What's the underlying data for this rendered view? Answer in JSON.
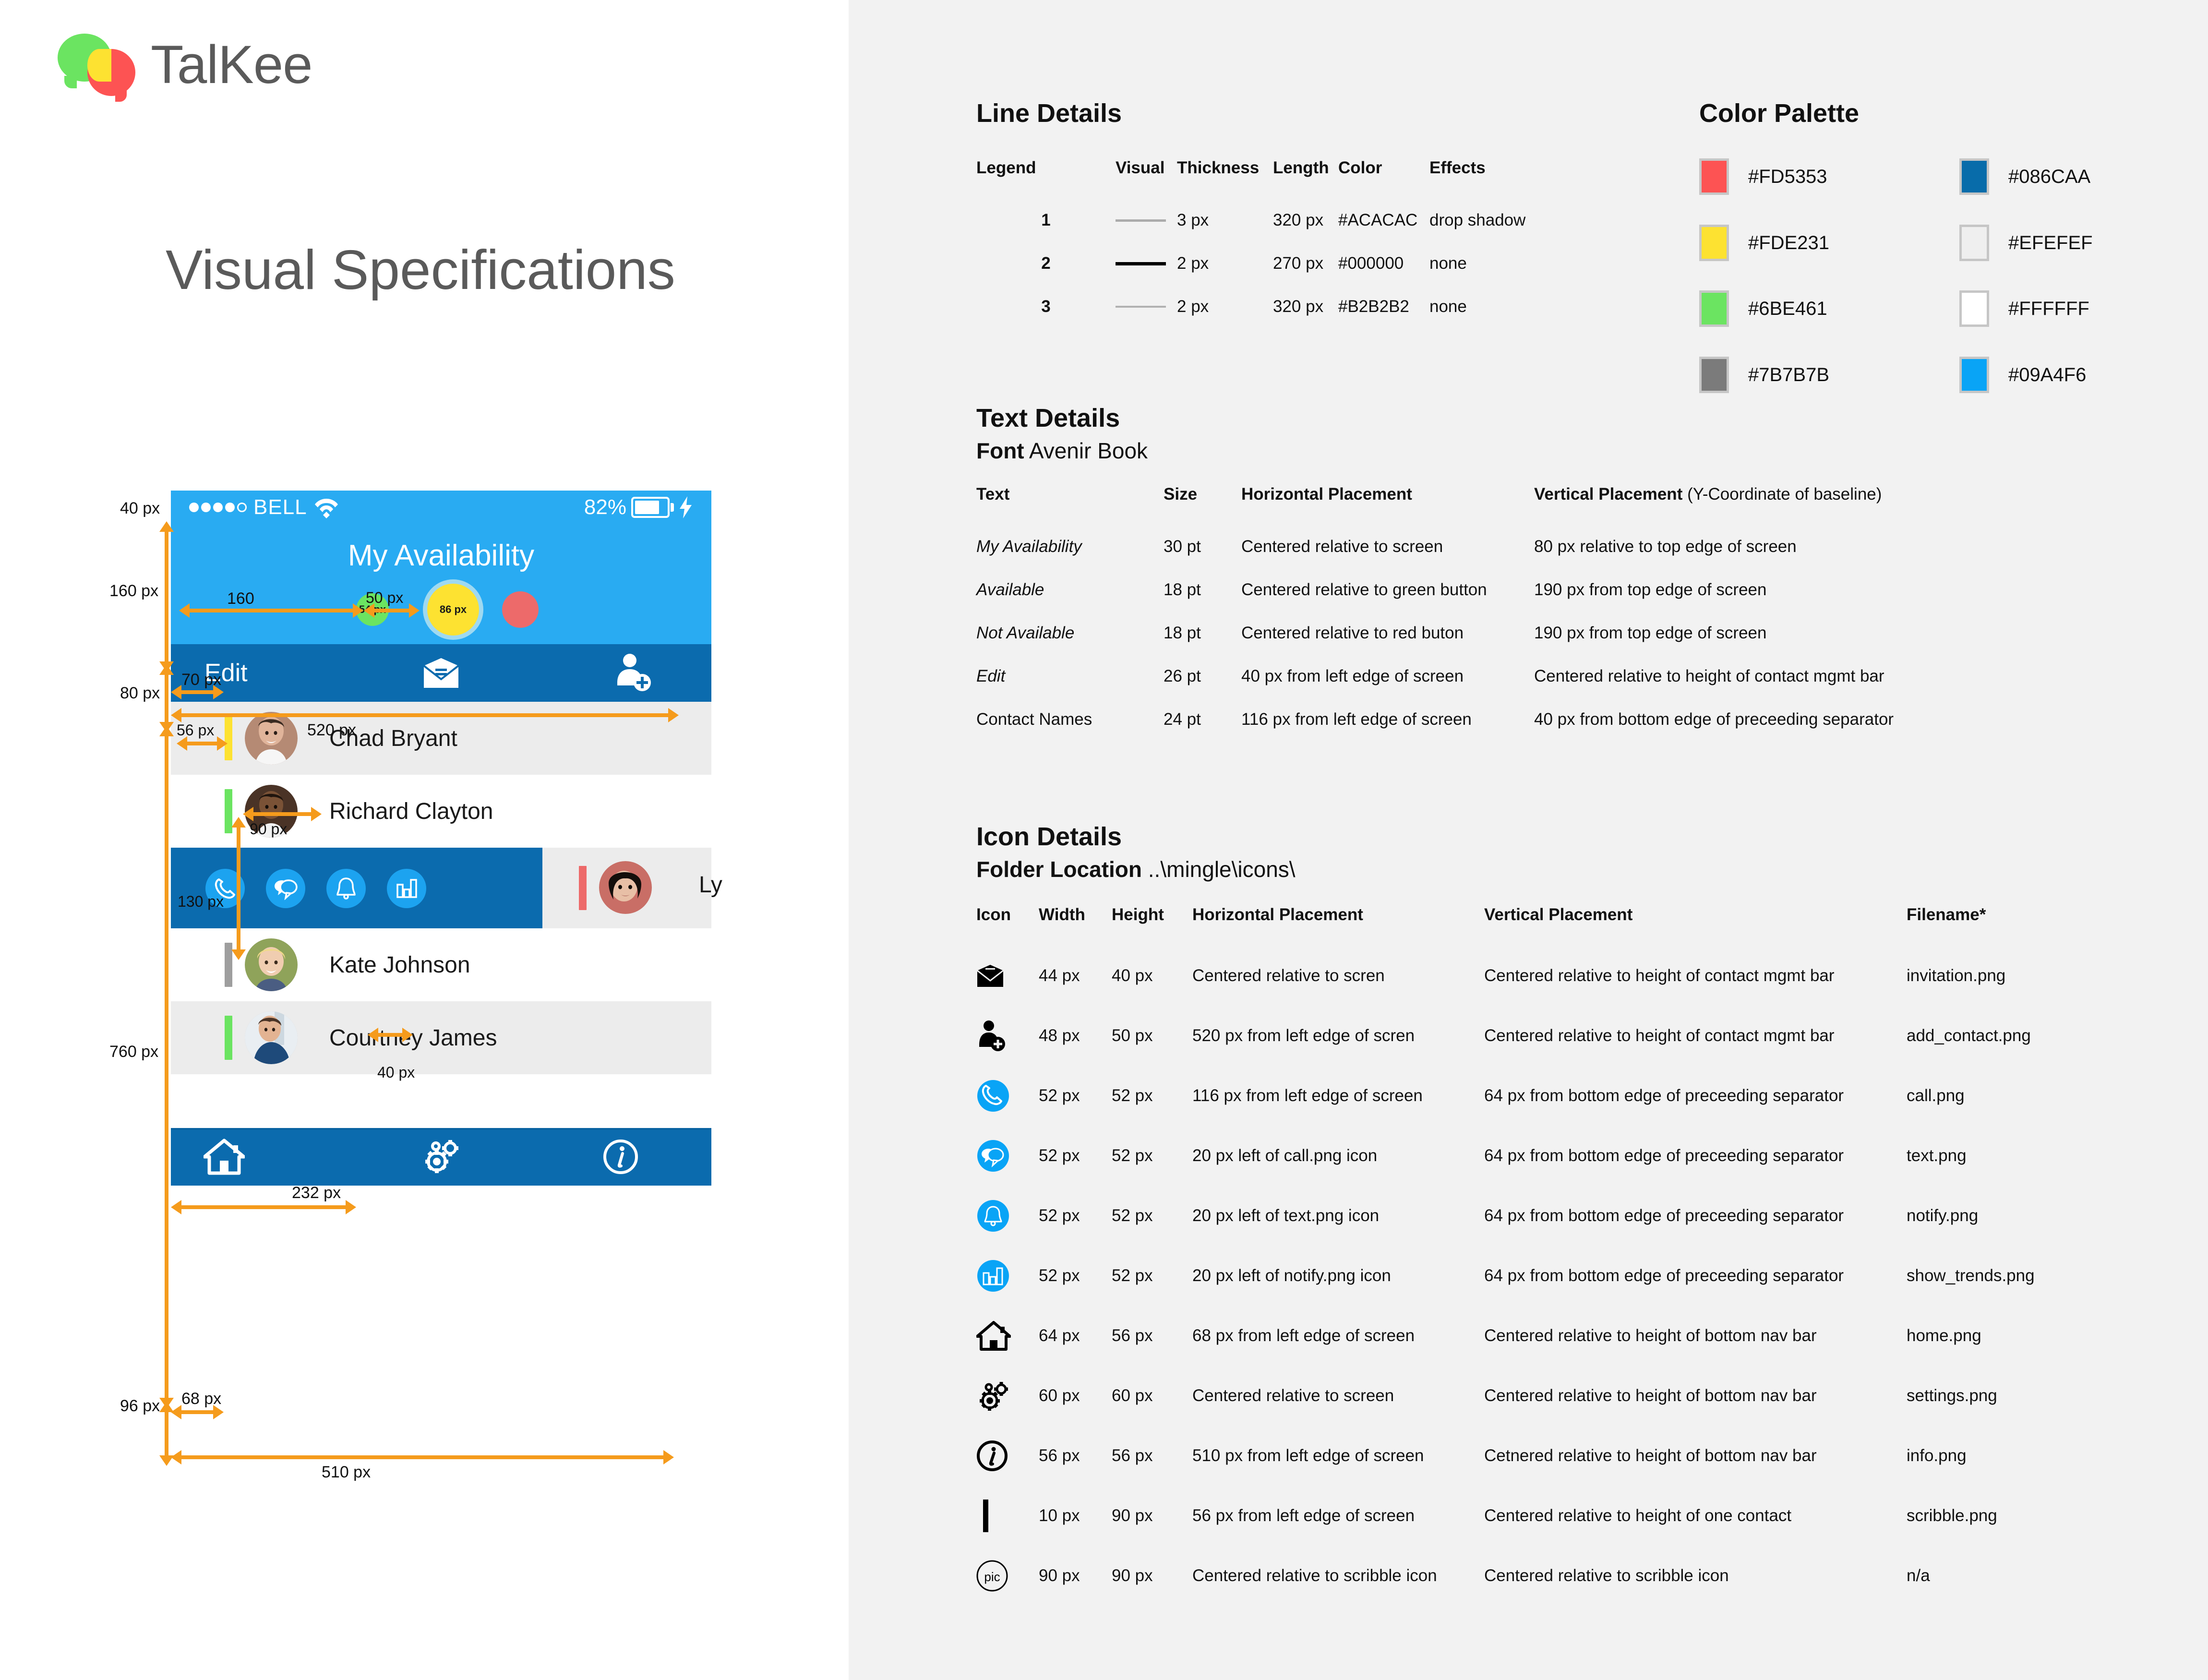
{
  "brand": {
    "name": "TalKee"
  },
  "page": {
    "title": "Visual Specifications"
  },
  "phone": {
    "status": {
      "carrier": "BELL",
      "battery_pct": "82%"
    },
    "hero_title": "My Availability",
    "buttons": {
      "green_label": "54 px",
      "yellow_label": "86 px"
    },
    "mgmt_bar": {
      "edit_label": "Edit"
    },
    "contacts": [
      {
        "name": "Chad Bryant",
        "scribble_color": "#FDE231"
      },
      {
        "name": "Richard Clayton",
        "scribble_color": "#6BE461"
      },
      {
        "name": "Ly",
        "scribble_color": "#ED6A6A"
      },
      {
        "name": "Kate Johnson",
        "scribble_color": "#9E9E9E"
      },
      {
        "name": "Courtney James",
        "scribble_color": "#6BE461"
      }
    ],
    "annotations": {
      "status_h": "40 px",
      "hero_h": "160 px",
      "mgmt_h": "80 px",
      "list_h": "760 px",
      "nav_h": "96 px",
      "green_offset": "160",
      "gap_green_yellow": "50 px",
      "edit_offset": "70 px",
      "mgmt_w": "520 px",
      "scribble_offset": "56 px",
      "avatar_w": "90 px",
      "contact_h": "130 px",
      "icon_gap": "40 px",
      "name_offset": "232 px",
      "home_offset": "68 px",
      "nav_w": "510 px"
    }
  },
  "line_details": {
    "heading": "Line Details",
    "columns": [
      "Legend",
      "Visual",
      "Thickness",
      "Length",
      "Color",
      "Effects"
    ],
    "rows": [
      {
        "legend": "1",
        "visual_color": "#ACACAC",
        "visual_thick": "3",
        "thickness": "3 px",
        "length": "320 px",
        "color": "#ACACAC",
        "effects": "drop shadow"
      },
      {
        "legend": "2",
        "visual_color": "#000000",
        "visual_thick": "4",
        "thickness": "2 px",
        "length": "270 px",
        "color": "#000000",
        "effects": "none"
      },
      {
        "legend": "3",
        "visual_color": "#B2B2B2",
        "visual_thick": "2",
        "thickness": "2 px",
        "length": "320 px",
        "color": "#B2B2B2",
        "effects": "none"
      }
    ]
  },
  "color_palette": {
    "heading": "Color Palette",
    "left": [
      {
        "hex": "#FD5353"
      },
      {
        "hex": "#FDE231"
      },
      {
        "hex": "#6BE461"
      },
      {
        "hex": "#7B7B7B"
      }
    ],
    "right": [
      {
        "hex": "#086CAA"
      },
      {
        "hex": "#EFEFEF"
      },
      {
        "hex": "#FFFFFF"
      },
      {
        "hex": "#09A4F6"
      }
    ]
  },
  "text_details": {
    "heading": "Text  Details",
    "font_label": "Font",
    "font_value": "Avenir Book",
    "columns": [
      "Text",
      "Size",
      "Horizontal Placement",
      "Vertical Placement",
      " (Y-Coordinate of baseline)"
    ],
    "rows": [
      {
        "text": "My Availability",
        "size": "30 pt",
        "h": "Centered relative to screen",
        "v": "80 px relative to top edge of screen"
      },
      {
        "text": "Available",
        "size": "18 pt",
        "h": "Centered relative to green button",
        "v": "190 px from top edge of screen"
      },
      {
        "text": "Not Available",
        "size": "18 pt",
        "h": "Centered relative to red buton",
        "v": "190 px from top edge of screen"
      },
      {
        "text": "Edit",
        "size": "26 pt",
        "h": "40 px from left edge of screen",
        "v": "Centered relative to height of contact mgmt bar"
      },
      {
        "text": "Contact Names",
        "size": "24 pt",
        "h": "116 px from left edge of screen",
        "v": "40 px from bottom edge of preceeding separator"
      }
    ]
  },
  "icon_details": {
    "heading": "Icon Details",
    "folder_label": "Folder Location",
    "folder_value": "..\\mingle\\icons\\",
    "columns": [
      "Icon",
      "Width",
      "Height",
      "Horizontal Placement",
      "Vertical Placement",
      "Filename*"
    ],
    "rows": [
      {
        "icon": "envelope-icon",
        "width": "44 px",
        "height": "40 px",
        "h": "Centered relative to scren",
        "v": "Centered relative to height of contact mgmt bar",
        "file": "invitation.png"
      },
      {
        "icon": "add-contact-icon",
        "width": "48 px",
        "height": "50 px",
        "h": "520 px from left edge of scren",
        "v": "Centered relative to height of contact mgmt bar",
        "file": "add_contact.png"
      },
      {
        "icon": "call-icon",
        "width": "52 px",
        "height": "52 px",
        "h": "116 px from left edge of screen",
        "v": "64 px from bottom edge of preceeding separator",
        "file": "call.png"
      },
      {
        "icon": "text-icon",
        "width": "52 px",
        "height": "52 px",
        "h": "20 px left of call.png icon",
        "v": "64 px from bottom edge of preceeding separator",
        "file": "text.png"
      },
      {
        "icon": "notify-icon",
        "width": "52 px",
        "height": "52 px",
        "h": "20 px left of text.png icon",
        "v": "64 px from bottom edge of preceeding separator",
        "file": "notify.png"
      },
      {
        "icon": "show-trends-icon",
        "width": "52 px",
        "height": "52 px",
        "h": "20 px left of notify.png icon",
        "v": "64 px from bottom edge of preceeding separator",
        "file": "show_trends.png"
      },
      {
        "icon": "home-icon",
        "width": "64 px",
        "height": "56 px",
        "h": "68 px from left edge of screen",
        "v": "Centered relative to height of bottom nav bar",
        "file": "home.png"
      },
      {
        "icon": "settings-icon",
        "width": "60 px",
        "height": "60 px",
        "h": "Centered relative to screen",
        "v": "Centered relative to height of bottom nav bar",
        "file": "settings.png"
      },
      {
        "icon": "info-icon",
        "width": "56 px",
        "height": "56 px",
        "h": "510 px from left edge of screen",
        "v": "Cetnered relative to height of bottom nav bar",
        "file": "info.png"
      },
      {
        "icon": "scribble-icon",
        "width": "10 px",
        "height": "90 px",
        "h": "56 px from left edge of screen",
        "v": "Centered relative to height of one contact",
        "file": "scribble.png"
      },
      {
        "icon": "pic-icon",
        "width": "90 px",
        "height": "90 px",
        "h": "Centered relative to scribble icon",
        "v": "Centered relative to scribble icon",
        "file": "n/a",
        "label": "pic"
      }
    ]
  }
}
